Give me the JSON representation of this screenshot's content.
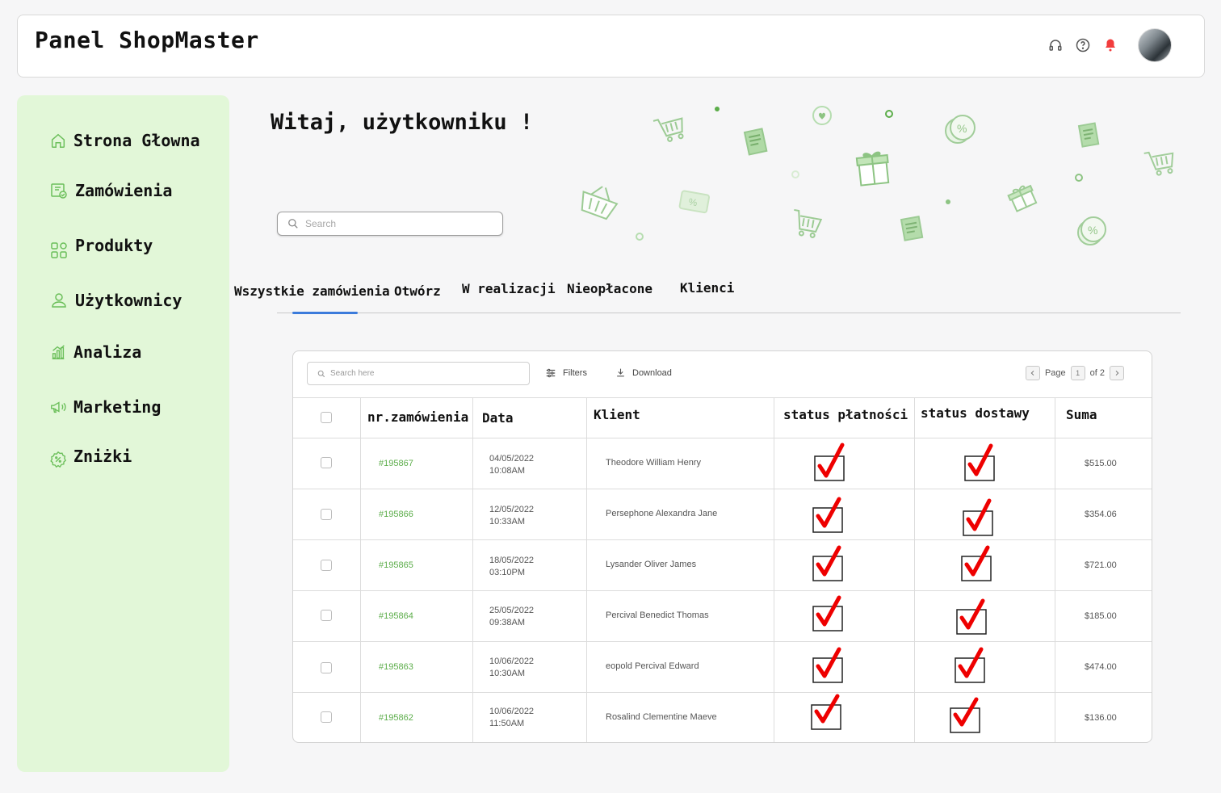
{
  "header": {
    "title": "Panel ShopMaster",
    "icons": [
      "headset-icon",
      "help-icon",
      "bell-icon"
    ]
  },
  "sidebar": {
    "items": [
      {
        "label": "Strona Głowna",
        "icon": "home-icon"
      },
      {
        "label": "Zamówienia",
        "icon": "orders-icon"
      },
      {
        "label": "Produkty",
        "icon": "grid-icon"
      },
      {
        "label": "Użytkownicy",
        "icon": "user-icon"
      },
      {
        "label": "Analiza",
        "icon": "chart-icon"
      },
      {
        "label": "Marketing",
        "icon": "megaphone-icon"
      },
      {
        "label": "Zniżki",
        "icon": "discount-icon"
      }
    ]
  },
  "hero": {
    "welcome": "Witaj, użytkowniku !",
    "search_placeholder": "Search"
  },
  "tabs": [
    "Wszystkie zamówienia",
    "Otwórz",
    "W realizacji",
    "Nieopłacone",
    "Klienci"
  ],
  "active_tab": "Wszystkie zamówienia",
  "toolbar": {
    "search_placeholder": "Search here",
    "filters_label": "Filters",
    "download_label": "Download",
    "page_label": "Page",
    "page_current": "1",
    "page_total_label": "of 2"
  },
  "table": {
    "columns": [
      "nr.zamówienia",
      "Data",
      "Klient",
      "status płatności",
      "status dostawy",
      "Suma"
    ],
    "rows": [
      {
        "id": "#195867",
        "date": "04/05/2022",
        "time": "10:08AM",
        "client": "Theodore William Henry",
        "paid": true,
        "delivered": true,
        "total": "$515.00"
      },
      {
        "id": "#195866",
        "date": "12/05/2022",
        "time": "10:33AM",
        "client": "Persephone Alexandra Jane",
        "paid": true,
        "delivered": true,
        "total": "$354.06"
      },
      {
        "id": "#195865",
        "date": "18/05/2022",
        "time": "03:10PM",
        "client": "Lysander Oliver James",
        "paid": true,
        "delivered": true,
        "total": "$721.00"
      },
      {
        "id": "#195864",
        "date": "25/05/2022",
        "time": "09:38AM",
        "client": "Percival Benedict Thomas",
        "paid": true,
        "delivered": true,
        "total": "$185.00"
      },
      {
        "id": "#195863",
        "date": "10/06/2022",
        "time": "10:30AM",
        "client": "eopold Percival Edward",
        "paid": true,
        "delivered": true,
        "total": "$474.00"
      },
      {
        "id": "#195862",
        "date": "10/06/2022",
        "time": "11:50AM",
        "client": "Rosalind Clementine Maeve",
        "paid": true,
        "delivered": true,
        "total": "$136.00"
      }
    ]
  },
  "colors": {
    "sidebar_bg": "#e2f7d8",
    "accent_green": "#5cad4a",
    "tab_underline": "#3b7bdb",
    "check_red": "#ee0000"
  }
}
